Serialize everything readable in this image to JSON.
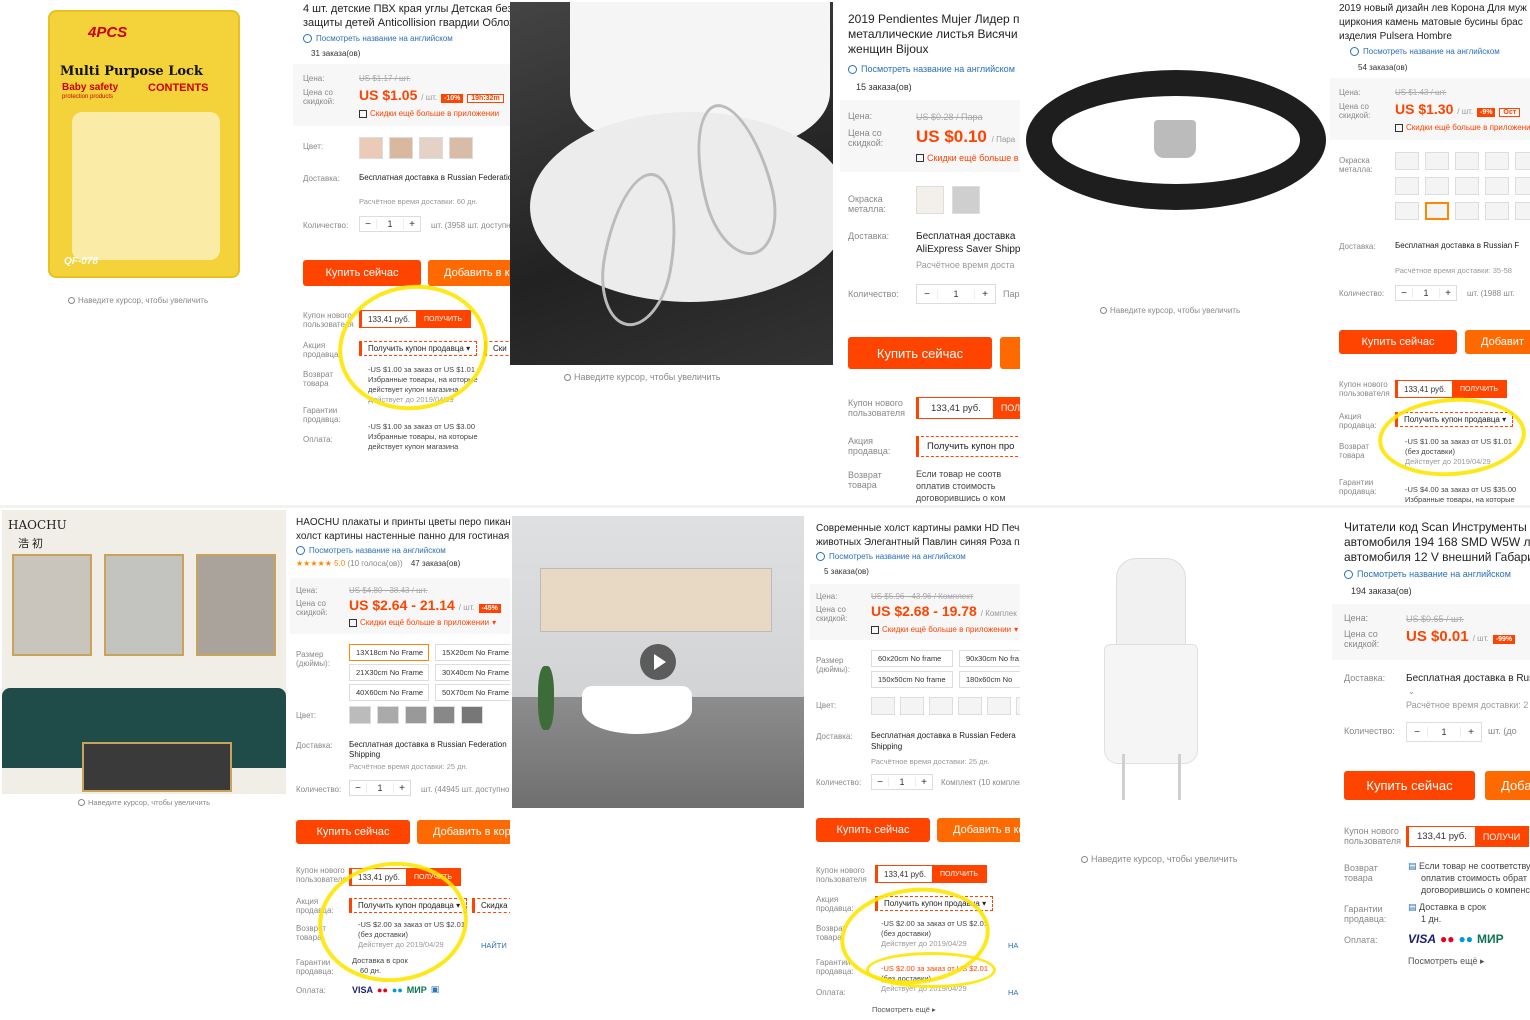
{
  "common": {
    "view_english": "Посмотреть название на английском",
    "zoom_hint": "Наведите курсор, чтобы увеличить",
    "price_label": "Цена:",
    "disc_price_label": "Цена со скидкой:",
    "color_label": "Цвет:",
    "metal_color_label": "Окраска металла:",
    "size_label": "Размер (дюймы):",
    "delivery_label": "Доставка:",
    "quantity_label": "Количество:",
    "new_user_coupon_label": "Купон нового пользователя",
    "seller_promo_label": "Акция продавца:",
    "return_label": "Возврат товара",
    "guarantee_label": "Гарантии продавца:",
    "payment_label": "Оплата:",
    "buy_now": "Купить сейчас",
    "add_to_cart": "Добавить в корзину",
    "coupon_amount": "133,41 руб.",
    "get_coupon": "ПОЛУЧИТЬ",
    "get_seller_coupon": "Получить купон продавца",
    "app_discount": "Скидки ещё больше в приложении",
    "free_ship_ru": "Бесплатная доставка в Russian Federation",
    "qty_value": "1",
    "minus": "−",
    "plus": "+"
  },
  "p1": {
    "package_badge": "4PCS",
    "package_title": "Multi Purpose Lock",
    "package_sub": "Baby safety",
    "package_sub2": "protection products",
    "package_contents": "CONTENTS",
    "package_code": "QF-078",
    "title_line1": "4 шт. детские ПВХ края углы Детская безопа",
    "title_line2": "защиты детей Anticollision гвардии Обложка",
    "orders": "31 заказа(ов)",
    "old_price": "US $1.17 / шт.",
    "price": "US $1.05",
    "unit": "/ шт.",
    "discount": "-10%",
    "timer": "19h:32m",
    "shipping_est": "Расчётное время доставки: 60 дн.",
    "stock": "шт. (3958 шт. доступно)",
    "promo_line1": "-US $1.00 за заказ от US $1.01",
    "promo_line2": "Избранные товары, на которые",
    "promo_line3": "действует купон магазина",
    "promo_valid": "Действует до 2019/04/29",
    "promo2_line1": "-US $1.00 за заказ от US $3.00",
    "promo2_line2": "Избранные товары, на которые",
    "promo2_line3": "действует купон магазина"
  },
  "p2": {
    "title_line1": "2019 Pendientes Mujer Лидер п",
    "title_line2": "металлические листья Висячи",
    "title_line3": "женщин Bijoux",
    "orders": "15 заказа(ов)",
    "old_price": "US $0.28 / Пара",
    "price": "US $0.10",
    "unit": "/ Пара",
    "delivery_main": "Бесплатная доставка",
    "delivery_sub": "AliExpress Saver Shipp",
    "shipping_est": "Расчётное время доста",
    "stock": "Пар",
    "coupon_get": "ПОЛ",
    "seller_coupon": "Получить купон про",
    "return_line1": "Если товар не соотв",
    "return_line2": "оплатив стоимость",
    "return_line3": "договорившись о ком"
  },
  "p3": {
    "title_line1": "2019 новый дизайн лев Корона Для муж",
    "title_line2": "циркония камень матовые бусины брас",
    "title_line3": "изделия Pulsera Hombre",
    "orders": "54 заказа(ов)",
    "old_price": "US $1.43 / шт.",
    "price": "US $1.30",
    "unit": "/ шт.",
    "discount": "-9%",
    "timer": "Ост",
    "delivery_main": "Бесплатная доставка в Russian F",
    "shipping_est": "Расчётное время доставки: 35-58",
    "stock": "шт. (1988 шт.",
    "add_cart_short": "Добавит",
    "promo_line1": "-US $1.00 за заказ от US $1.01",
    "promo_line2": "(без доставки)",
    "promo_valid": "Действует до 2019/04/29",
    "promo2_line1": "-US $4.00 за заказ от US $35.00",
    "promo2_line2": "Избранные товары, на которые"
  },
  "p4": {
    "brand": "HAOCHU",
    "brand_cn": "浩 初",
    "title_line1": "HAOCHU плакаты и принты цветы перо пикантн",
    "title_line2": "холст картины настенные панно для гостиная ук",
    "rating": "5.0",
    "votes": "(10 голоса(ов))",
    "orders": "47 заказа(ов)",
    "old_price": "US $4.80 - 38.43 / шт.",
    "price": "US $2.64 - 21.14",
    "unit": "/ шт.",
    "discount": "-45%",
    "sizes": [
      "13X18cm No Frame",
      "15X20cm No Frame",
      "21X30cm No Frame",
      "30X40cm No Frame",
      "40X60cm No Frame",
      "50X70cm No Frame"
    ],
    "shipping_line2": "Shipping",
    "shipping_est": "Расчётное время доставки: 25 дн.",
    "stock": "шт. (44945 шт. доступно)",
    "seller_promo2": "Скидка U",
    "promo_line1": "-US $2.00 за заказ от US $2.01",
    "promo_line2": "(без доставки)",
    "promo_valid": "Действует до 2019/04/29",
    "find": "НАЙТИ",
    "guarantee1": "Доставка в срок",
    "guarantee2": "60 дн."
  },
  "p5": {
    "title_line1": "Современные холст картины рамки HD Печа",
    "title_line2": "животных Элегантный Павлин синяя Роза пл",
    "orders": "5 заказа(ов)",
    "old_price": "US $5.96 - 43.96 / Комплект",
    "price": "US $2.68 - 19.78",
    "unit": "/ Комплек",
    "sizes": [
      "60x20cm No frame",
      "90x30cm No fra",
      "150x50cm No frame",
      "180x60cm No"
    ],
    "delivery_main": "Бесплатная доставка в Russian Federa",
    "shipping_line2": "Shipping",
    "shipping_est": "Расчётное время доставки: 25 дн.",
    "stock": "Комплект (10 комплек",
    "promo_line1": "-US $2.00 за заказ от US $2.01",
    "promo_line2": "(без доставки)",
    "promo_valid": "Действует до 2019/04/29",
    "promo2_line1": "-US $2.00 за заказ от US $2.01",
    "promo2_line2": "(без доставки)",
    "promo2_valid": "Действует до 2019/04/29",
    "na": "НА",
    "see_more": "Посмотреть ещё"
  },
  "p6": {
    "title_line1": "Читатели код Scan Инструменты 1 ш",
    "title_line2": "автомобиля 194 168 SMD W5W лам",
    "title_line3": "автомобиля 12 V внешний Габарит",
    "orders": "194 заказа(ов)",
    "old_price": "US $0.65 / шт.",
    "price": "US $0.01",
    "unit": "/ шт.",
    "discount": "-99%",
    "delivery_main": "Бесплатная доставка в Russ",
    "shipping_est": "Расчётное время доставки: 2",
    "stock": "шт. (до",
    "add_cart_short": "Доба",
    "coupon_get": "ПОЛУЧИ",
    "return_line1": "Если товар не соответству",
    "return_line2": "оплатив стоимость обрат",
    "return_line3": "договорившись о компенса",
    "guarantee1": "Доставка в срок",
    "guarantee2": "1 дн.",
    "see_more": "Посмотреть ещё",
    "payment_logos": [
      "VISA",
      "MC",
      "Maestro",
      "МИР"
    ]
  },
  "colors": {
    "accent": "#ff4400",
    "cart": "#ff6a00",
    "link": "#2a6fb8",
    "highlight": "#ffe500"
  }
}
